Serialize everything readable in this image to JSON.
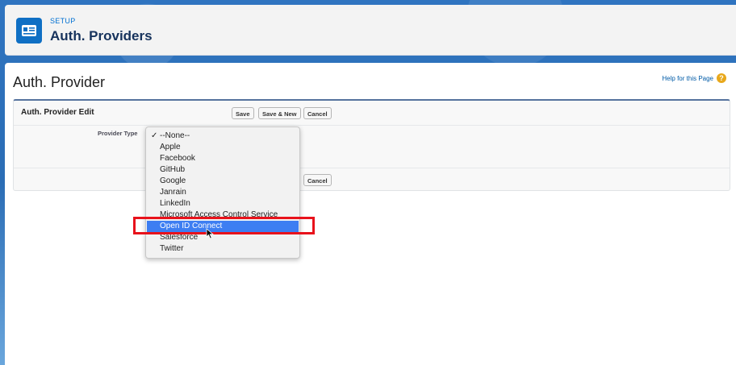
{
  "header": {
    "eyebrow": "SETUP",
    "title": "Auth. Providers",
    "icon": "id-card-icon"
  },
  "page": {
    "title": "Auth. Provider",
    "help_link": "Help for this Page",
    "help_icon": "?"
  },
  "panel": {
    "title": "Auth. Provider Edit",
    "buttons": {
      "save": "Save",
      "save_new": "Save & New",
      "cancel": "Cancel"
    },
    "field_label": "Provider Type",
    "bottom_cancel": "Cancel"
  },
  "dropdown": {
    "check": "✓",
    "options": [
      "--None--",
      "Apple",
      "Facebook",
      "GitHub",
      "Google",
      "Janrain",
      "LinkedIn",
      "Microsoft Access Control Service",
      "Open ID Connect",
      "Salesforce",
      "Twitter"
    ],
    "selected_index": 8,
    "checked_index": 0
  },
  "colors": {
    "highlight": "#e8121b",
    "selected": "#3d7ef2",
    "brand": "#0f6fc4"
  }
}
